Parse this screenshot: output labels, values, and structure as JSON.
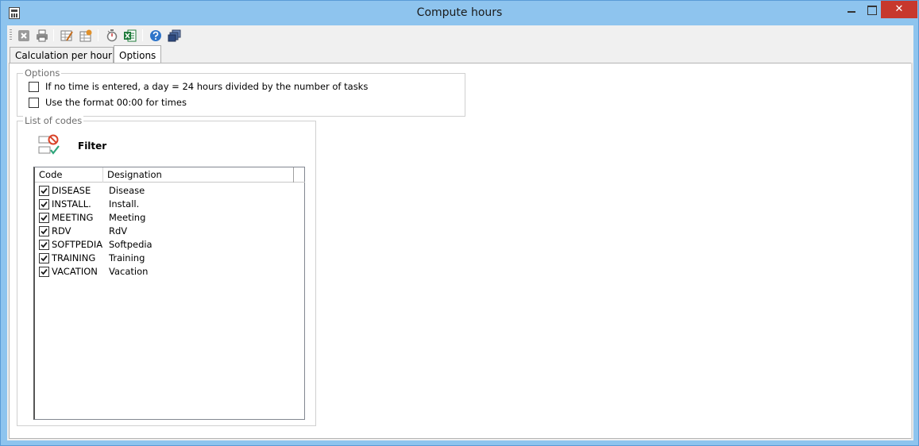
{
  "window": {
    "title": "Compute hours",
    "close_glyph": "✕"
  },
  "toolbar": {
    "items": [
      {
        "icon": "close-icon",
        "color": "#8a8a8a"
      },
      {
        "icon": "print-icon",
        "color": "#6b6b6b"
      },
      {
        "icon": "table-edit-icon",
        "color": "#c26a1a"
      },
      {
        "icon": "table-config-icon",
        "color": "#c26a1a"
      },
      {
        "icon": "stopwatch-icon",
        "color": "#7a7a7a"
      },
      {
        "icon": "excel-icon",
        "color": "#1e7a3a"
      },
      {
        "icon": "help-icon",
        "color": "#2f75c9"
      },
      {
        "icon": "windows-icon",
        "color": "#3a4f7a"
      }
    ]
  },
  "tabs": [
    {
      "label": "Calculation per hour",
      "active": false
    },
    {
      "label": "Options",
      "active": true
    }
  ],
  "options_group": {
    "title": "Options",
    "items": [
      {
        "label": "If no time is entered, a day = 24 hours divided by the number of tasks",
        "checked": false
      },
      {
        "label": "Use the format 00:00 for times",
        "checked": false
      }
    ]
  },
  "codes_group": {
    "title": "List of codes",
    "filter_label": "Filter",
    "columns": [
      "Code",
      "Designation"
    ],
    "rows": [
      {
        "code": "DISEASE",
        "designation": "Disease",
        "checked": true
      },
      {
        "code": "INSTALL.",
        "designation": "Install.",
        "checked": true
      },
      {
        "code": "MEETING",
        "designation": "Meeting",
        "checked": true
      },
      {
        "code": "RDV",
        "designation": "RdV",
        "checked": true
      },
      {
        "code": "SOFTPEDIA",
        "designation": "Softpedia",
        "checked": true
      },
      {
        "code": "TRAINING",
        "designation": "Training",
        "checked": true
      },
      {
        "code": "VACATION",
        "designation": "Vacation",
        "checked": true
      }
    ]
  },
  "colors": {
    "titlebar": "#8ec4ee",
    "close_button": "#c7382d",
    "panel": "#ffffff",
    "check": "#1a1a1a"
  }
}
